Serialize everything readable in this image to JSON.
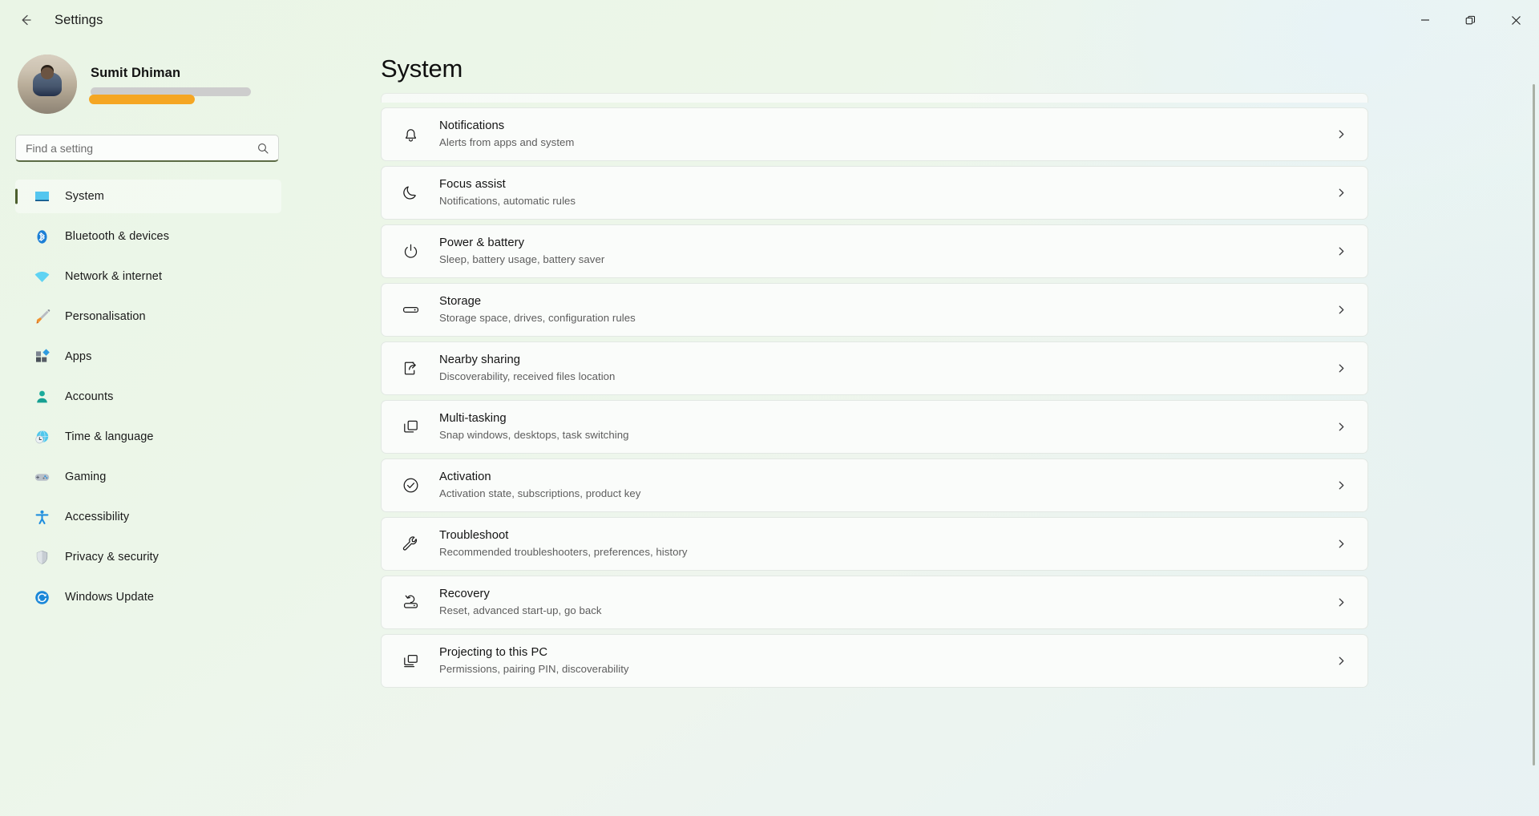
{
  "window": {
    "title": "Settings",
    "back_icon": "arrow-left-icon",
    "controls": {
      "minimize": "minimize-icon",
      "maximize": "restore-icon",
      "close": "close-icon"
    }
  },
  "sidebar": {
    "profile": {
      "name": "Sumit Dhiman",
      "avatar": "user-avatar-photo",
      "redacted_email": "",
      "redacted_link": ""
    },
    "search": {
      "placeholder": "Find a setting",
      "value": "",
      "icon": "search-icon"
    },
    "items": [
      {
        "label": "System",
        "icon": "monitor-icon",
        "active": true
      },
      {
        "label": "Bluetooth & devices",
        "icon": "bluetooth-icon",
        "active": false
      },
      {
        "label": "Network & internet",
        "icon": "wifi-icon",
        "active": false
      },
      {
        "label": "Personalisation",
        "icon": "paintbrush-icon",
        "active": false
      },
      {
        "label": "Apps",
        "icon": "apps-icon",
        "active": false
      },
      {
        "label": "Accounts",
        "icon": "person-icon",
        "active": false
      },
      {
        "label": "Time & language",
        "icon": "clock-globe-icon",
        "active": false
      },
      {
        "label": "Gaming",
        "icon": "gamepad-icon",
        "active": false
      },
      {
        "label": "Accessibility",
        "icon": "accessibility-icon",
        "active": false
      },
      {
        "label": "Privacy & security",
        "icon": "shield-icon",
        "active": false
      },
      {
        "label": "Windows Update",
        "icon": "update-icon",
        "active": false
      }
    ]
  },
  "main": {
    "title": "System",
    "cards": [
      {
        "title": "Notifications",
        "subtitle": "Alerts from apps and system",
        "icon": "bell-icon"
      },
      {
        "title": "Focus assist",
        "subtitle": "Notifications, automatic rules",
        "icon": "moon-icon"
      },
      {
        "title": "Power & battery",
        "subtitle": "Sleep, battery usage, battery saver",
        "icon": "power-icon"
      },
      {
        "title": "Storage",
        "subtitle": "Storage space, drives, configuration rules",
        "icon": "drive-icon"
      },
      {
        "title": "Nearby sharing",
        "subtitle": "Discoverability, received files location",
        "icon": "share-icon"
      },
      {
        "title": "Multi-tasking",
        "subtitle": "Snap windows, desktops, task switching",
        "icon": "windows-stack-icon"
      },
      {
        "title": "Activation",
        "subtitle": "Activation state, subscriptions, product key",
        "icon": "check-circle-icon"
      },
      {
        "title": "Troubleshoot",
        "subtitle": "Recommended troubleshooters, preferences, history",
        "icon": "wrench-icon"
      },
      {
        "title": "Recovery",
        "subtitle": "Reset, advanced start-up, go back",
        "icon": "recovery-icon"
      },
      {
        "title": "Projecting to this PC",
        "subtitle": "Permissions, pairing PIN, discoverability",
        "icon": "project-screen-icon"
      }
    ],
    "chevron_icon": "chevron-right-icon"
  },
  "colors": {
    "accent": "#4c5f2e",
    "card_bg": "#fafcfa",
    "redact_gray": "#cdcdcd",
    "redact_orange": "#f5a623"
  }
}
